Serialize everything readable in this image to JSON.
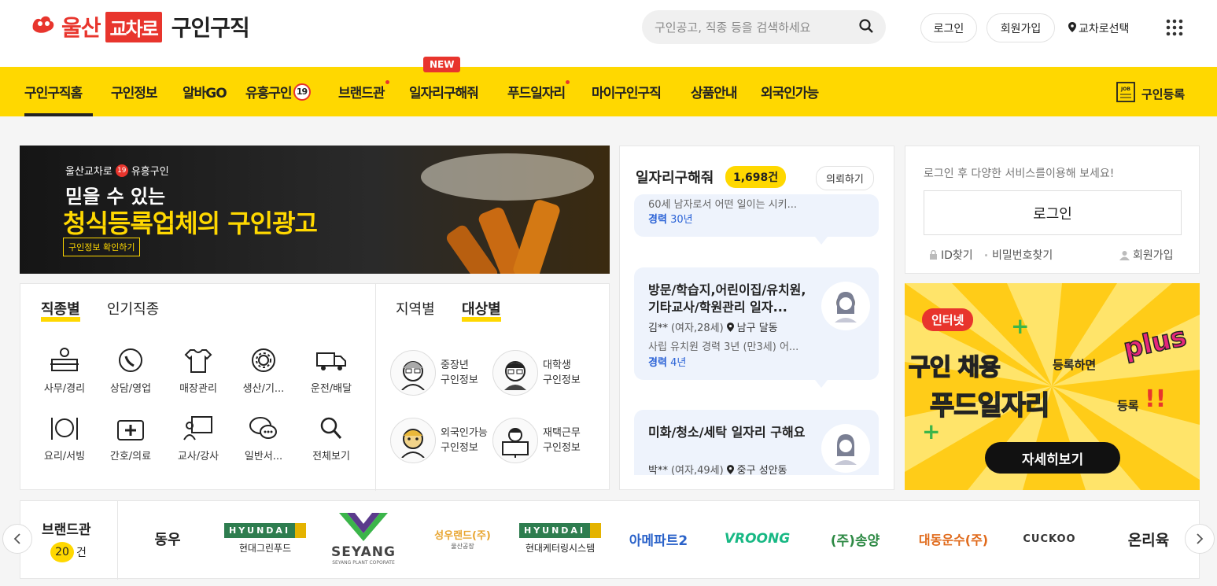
{
  "header": {
    "logo_city": "울산",
    "logo_box": "교차로",
    "logo_service": "구인구직",
    "search_placeholder": "구인공고, 직종 등을 검색하세요",
    "login": "로그인",
    "signup": "회원가입",
    "region": "교차로선택"
  },
  "nav": {
    "items": [
      "구인구직홈",
      "구인정보",
      "알바GO",
      "유흥구인",
      "브랜드관",
      "일자리구해줘",
      "푸드일자리",
      "마이구인구직",
      "상품안내",
      "외국인가능"
    ],
    "badge_19": "19",
    "new_badge": "NEW",
    "register": "구인등록"
  },
  "banner": {
    "top": "울산교차로",
    "badge": "19",
    "top2": "유흥구인",
    "line1": "믿을 수 있는",
    "line2": "청식등록업체의 구인광고",
    "btn": "구인정보 확인하기"
  },
  "category_tabs": [
    "직종별",
    "인기직종"
  ],
  "target_tabs": [
    "지역별",
    "대상별"
  ],
  "categories": [
    "사무/경리",
    "상담/영업",
    "매장관리",
    "생산/기...",
    "운전/배달",
    "요리/서빙",
    "간호/의료",
    "교사/강사",
    "일반서...",
    "전체보기"
  ],
  "targets": [
    {
      "l1": "중장년",
      "l2": "구인정보"
    },
    {
      "l1": "대학생",
      "l2": "구인정보"
    },
    {
      "l1": "외국인가능",
      "l2": "구인정보"
    },
    {
      "l1": "재택근무",
      "l2": "구인정보"
    }
  ],
  "jobseek": {
    "title": "일자리구해줘",
    "count": "1,698건",
    "request": "의뢰하기",
    "items": [
      {
        "desc": "60세 남자로서 어떤 일이는 시키...",
        "career_label": "경력",
        "career": "30년"
      },
      {
        "title": "방문/학습지,어린이집/유치원,기타교사/학원관리 일자...",
        "name": "김**",
        "info": "(여자,28세)",
        "loc": "남구 달동",
        "desc": "사립 유치원 경력 3년 (만3세) 어...",
        "career_label": "경력",
        "career": "4년"
      },
      {
        "title": "미화/청소/세탁 일자리 구해요",
        "name": "박**",
        "info": "(여자,49세)",
        "loc": "중구 성안동"
      }
    ]
  },
  "login_box": {
    "msg": "로그인 후 다양한 서비스를이용해 보세요!",
    "btn": "로그인",
    "find_id": "ID찾기",
    "find_pw": "비밀번호찾기",
    "join": "회원가입"
  },
  "ad": {
    "tag": "인터넷",
    "line1a": "구인 채용",
    "line1b": "등록하면",
    "plus": "plus",
    "line2a": "푸드일자리",
    "line2b": "등록",
    "excl": "!!",
    "btn": "자세히보기"
  },
  "brands": {
    "title": "브랜드관",
    "count": "20",
    "unit": "건",
    "items": [
      {
        "name": "동우",
        "sub": ""
      },
      {
        "name": "HYUNDAI",
        "sub": "현대그린푸드"
      },
      {
        "name": "SEYANG",
        "sub": "SEYANG PLANT COPORATE"
      },
      {
        "name": "성우랜드(주)",
        "sub": "울산공장"
      },
      {
        "name": "HYUNDAI",
        "sub": "현대케터링시스템"
      },
      {
        "name": "아메파트2",
        "sub": ""
      },
      {
        "name": "VROONG",
        "sub": ""
      },
      {
        "name": "(주)송양",
        "sub": ""
      },
      {
        "name": "대동운수(주)",
        "sub": ""
      },
      {
        "name": "CUCKOO",
        "sub": ""
      },
      {
        "name": "온리육",
        "sub": ""
      }
    ]
  },
  "colors": {
    "brand_red": "#e8352d",
    "nav_yellow": "#ffd800",
    "career_blue": "#2a62d6",
    "bubble": "#eef3fc"
  }
}
